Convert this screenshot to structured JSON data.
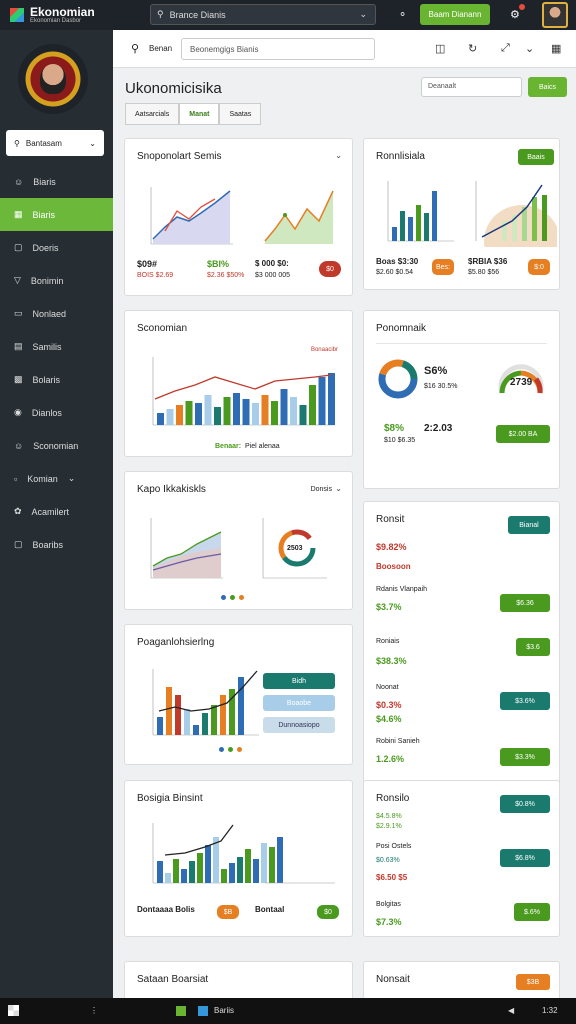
{
  "app": {
    "title": "Ekonomian",
    "subtitle": "Ekonomian Dasbor",
    "top_search": "Brance Dianis",
    "top_button": "Baam Dianann"
  },
  "sidebar": {
    "search_label": "Bantasam",
    "items": [
      {
        "label": "Biaris",
        "icon": "user-icon"
      },
      {
        "label": "Biaris",
        "icon": "grid-icon"
      },
      {
        "label": "Doeris",
        "icon": "file-icon"
      },
      {
        "label": "Bonimin",
        "icon": "filter-icon"
      },
      {
        "label": "Nonlaed",
        "icon": "folder-icon"
      },
      {
        "label": "Samilis",
        "icon": "clipboard-icon"
      },
      {
        "label": "Bolaris",
        "icon": "calendar-icon"
      },
      {
        "label": "Dianlos",
        "icon": "map-pin-icon"
      },
      {
        "label": "Sconomian",
        "icon": "people-icon"
      },
      {
        "label": "Komian",
        "icon": "chart-icon"
      },
      {
        "label": "Acamilert",
        "icon": "share-icon"
      },
      {
        "label": "Boaribs",
        "icon": "chat-icon"
      }
    ]
  },
  "toolbar": {
    "search_label": "Benan",
    "input_placeholder": "Beonemgigs Bianis"
  },
  "page": {
    "title": "Ukonomicisika",
    "title_input": "Deanaalt",
    "title_button": "Baics",
    "tabs": [
      "Aatsarcials",
      "Manat",
      "Saatas"
    ]
  },
  "cards": {
    "c1": {
      "title": "Snoponolart Semis",
      "v1": "$09#",
      "v2": "$BI%",
      "v3": "$ 000 $0:",
      "s1": "BOIS $2.69",
      "s2": "$2.36 $50%",
      "s3": "$3 000 005",
      "badge": "$0"
    },
    "c2": {
      "title": "Ronnlisiala",
      "button": "Baais",
      "v1": "Boas $3:30",
      "v2": "Bes:",
      "v3": "$RBIA $36",
      "s1": "$2.60 $0.54",
      "s2": "$5.80 $56",
      "badge": "$:0"
    },
    "c3": {
      "title": "Sconomian",
      "legend": "Bonaacibr",
      "footer1": "Benaar:",
      "footer2": "Piel alenaa"
    },
    "c4": {
      "title": "Ponomnaik",
      "v1": "S6%",
      "s1": "$16 30.5%",
      "gauge": "2739",
      "v2": "$8%",
      "v3": "2:2.03",
      "s2": "$10 $6.35",
      "button": "$2.00 BA"
    },
    "c5": {
      "title": "Kapo Ikkakiskls",
      "dropdown": "Donsis",
      "donut": "2503"
    },
    "c6": {
      "title": "Ronsit",
      "button": "Bianal",
      "r1": "$9.82%",
      "r2": "Boosoon",
      "r3": "Rdanis Vlanpaih",
      "r4": "$3.7%",
      "btn2": "$6.36",
      "r5": "Roniais",
      "r6": "$38.3%",
      "btn3": "$3.6",
      "r7": "Noonat",
      "r8": "$0.3%",
      "r9": "$4.6%",
      "btn4": "$3.6%",
      "r10": "Robini Sanieh",
      "r11": "1.2.6%",
      "btn5": "$3.3%"
    },
    "c7": {
      "title": "Poaganlohsierlng",
      "b1": "Bidh",
      "b2": "Boaobe",
      "b3": "Dunnoasiopo"
    },
    "c8": {
      "title": "Bosigia Binsint",
      "f1": "Dontaaaa Bolis",
      "f1b": "$B",
      "f2": "Bontaal",
      "f2b": "$0"
    },
    "c9": {
      "title": "Ronsilo",
      "btn1": "$0.8%",
      "s1": "$4.5.8%",
      "s2": "$2.9.1%",
      "r1": "Posi Ostels",
      "btn2": "$6.8%",
      "r2": "$0.63%",
      "r3": "$6.50 $5",
      "r4": "Bolgitas",
      "btn3": "$.6%",
      "r5": "$7.3%"
    },
    "c10": {
      "title": "Sataan Boarsiat"
    },
    "c11": {
      "title": "Nonsait",
      "btn": "$3B"
    }
  },
  "taskbar": {
    "app": "Bariis",
    "time": "1:32"
  },
  "colors": {
    "green": "#69b531",
    "teal": "#1a7a6e",
    "orange": "#e67e22",
    "red": "#c0392b",
    "blue": "#2e6db4",
    "sidebar": "#262d33"
  }
}
